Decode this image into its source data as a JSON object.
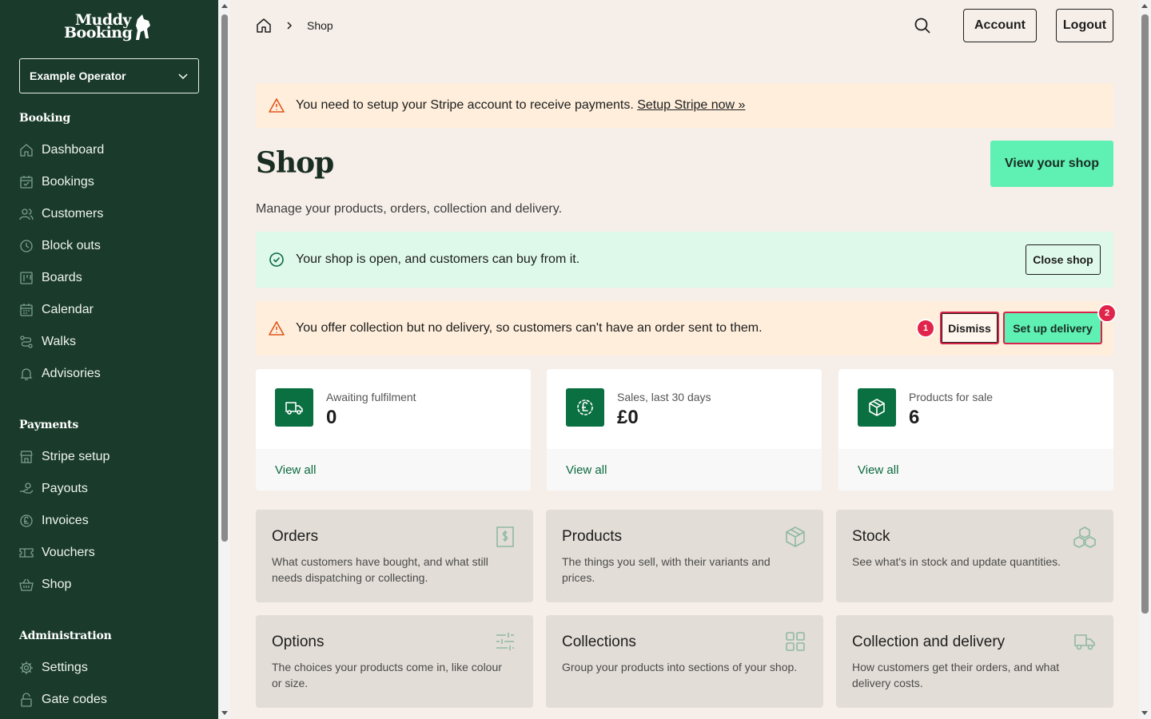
{
  "brand": {
    "line1": "Muddy",
    "line2": "Booking"
  },
  "operator": {
    "selected": "Example Operator"
  },
  "sidebar": {
    "sections": [
      {
        "title": "Booking"
      },
      {
        "title": "Payments"
      },
      {
        "title": "Administration"
      }
    ],
    "booking_items": [
      "Dashboard",
      "Bookings",
      "Customers",
      "Block outs",
      "Boards",
      "Calendar",
      "Walks",
      "Advisories"
    ],
    "payments_items": [
      "Stripe setup",
      "Payouts",
      "Invoices",
      "Vouchers",
      "Shop"
    ],
    "admin_items": [
      "Settings",
      "Gate codes"
    ]
  },
  "header": {
    "breadcrumb_current": "Shop",
    "account_label": "Account",
    "logout_label": "Logout"
  },
  "alerts": {
    "stripe_text": "You need to setup your Stripe account to receive payments.",
    "stripe_link": "Setup Stripe now »",
    "open_text": "Your shop is open, and customers can buy from it.",
    "close_label": "Close shop",
    "delivery_text": "You offer collection but no delivery, so customers can't have an order sent to them.",
    "dismiss_label": "Dismiss",
    "setup_delivery_label": "Set up delivery",
    "badge_1": "1",
    "badge_2": "2"
  },
  "page": {
    "title": "Shop",
    "view_shop_label": "View your shop",
    "subtitle": "Manage your products, orders, collection and delivery."
  },
  "stats": [
    {
      "label": "Awaiting fulfilment",
      "value": "0",
      "link": "View all"
    },
    {
      "label": "Sales, last 30 days",
      "value": "£0",
      "link": "View all"
    },
    {
      "label": "Products for sale",
      "value": "6",
      "link": "View all"
    }
  ],
  "tiles": [
    {
      "title": "Orders",
      "desc": "What customers have bought, and what still needs dispatching or collecting."
    },
    {
      "title": "Products",
      "desc": "The things you sell, with their variants and prices."
    },
    {
      "title": "Stock",
      "desc": "See what's in stock and update quantities."
    },
    {
      "title": "Options",
      "desc": "The choices your products come in, like colour or size."
    },
    {
      "title": "Collections",
      "desc": "Group your products into sections of your shop."
    },
    {
      "title": "Collection and delivery",
      "desc": "How customers get their orders, and what delivery costs."
    }
  ],
  "colors": {
    "sidebar": "#1a3b2b",
    "accent": "#5ff0b4",
    "icon_green": "#0b7041",
    "warn_bg": "#feeedb",
    "ok_bg": "#def9ea",
    "highlight": "#d6244a"
  }
}
